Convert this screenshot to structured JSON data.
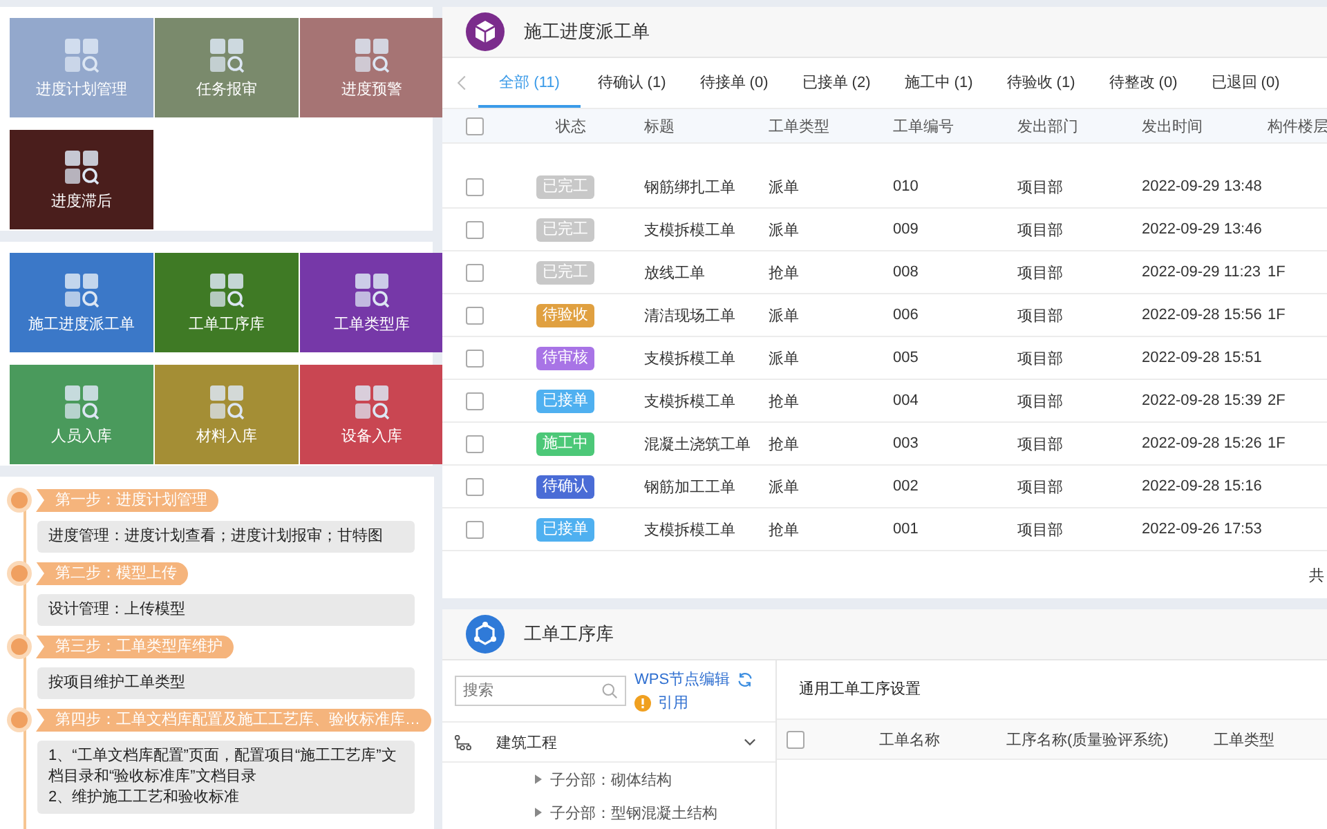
{
  "tile_groups": [
    {
      "tiles": [
        {
          "label": "进度计划管理",
          "color": "#93a8cc"
        },
        {
          "label": "任务报审",
          "color": "#7a8a6c"
        },
        {
          "label": "进度预警",
          "color": "#a67474"
        },
        {
          "label": "进度滞后",
          "color": "#4a1e1c"
        }
      ]
    },
    {
      "tiles": [
        {
          "label": "施工进度派工单",
          "color": "#3b78c8"
        },
        {
          "label": "工单工序库",
          "color": "#3f7a25"
        },
        {
          "label": "工单类型库",
          "color": "#7638a8"
        },
        {
          "label": "人员入库",
          "color": "#4a9a5c"
        },
        {
          "label": "材料入库",
          "color": "#a48e35"
        },
        {
          "label": "设备入库",
          "color": "#c94652"
        }
      ]
    }
  ],
  "steps": [
    {
      "title": "第一步：进度计划管理",
      "content": [
        "进度管理：进度计划查看；进度计划报审；甘特图"
      ]
    },
    {
      "title": "第二步：模型上传",
      "content": [
        "设计管理：上传模型"
      ]
    },
    {
      "title": "第三步：工单类型库维护",
      "content": [
        "按项目维护工单类型"
      ]
    },
    {
      "title": "第四步：工单文档库配置及施工工艺库、验收标准库…",
      "content": [
        "1、“工单文档库配置”页面，配置项目“施工工艺库”文档目录和“验收标准库”文档目录",
        "2、维护施工工艺和验收标准"
      ]
    }
  ],
  "work_orders": {
    "title": "施工进度派工单",
    "tabs": [
      {
        "label": "全部 (11)",
        "selected": true
      },
      {
        "label": "待确认 (1)",
        "selected": false
      },
      {
        "label": "待接单 (0)",
        "selected": false
      },
      {
        "label": "已接单 (2)",
        "selected": false
      },
      {
        "label": "施工中 (1)",
        "selected": false
      },
      {
        "label": "待验收 (1)",
        "selected": false
      },
      {
        "label": "待整改 (0)",
        "selected": false
      },
      {
        "label": "已退回 (0)",
        "selected": false
      }
    ],
    "header_checked": false,
    "columns": [
      "状态",
      "标题",
      "工单类型",
      "工单编号",
      "发出部门",
      "发出时间",
      "构件楼层"
    ],
    "rows": [
      {
        "checked": false,
        "status": "已完工",
        "color": "#c8c8c8",
        "title": "钢筋绑扎工单",
        "type": "派单",
        "number": "010",
        "dept": "项目部",
        "time": "2022-09-29 13:48",
        "floor": ""
      },
      {
        "checked": false,
        "status": "已完工",
        "color": "#c8c8c8",
        "title": "支模拆模工单",
        "type": "派单",
        "number": "009",
        "dept": "项目部",
        "time": "2022-09-29 13:46",
        "floor": ""
      },
      {
        "checked": false,
        "status": "已完工",
        "color": "#c8c8c8",
        "title": "放线工单",
        "type": "抢单",
        "number": "008",
        "dept": "项目部",
        "time": "2022-09-29 11:23",
        "floor": "1F"
      },
      {
        "checked": false,
        "status": "待验收",
        "color": "#e0a040",
        "title": "清洁现场工单",
        "type": "派单",
        "number": "006",
        "dept": "项目部",
        "time": "2022-09-28 15:56",
        "floor": "1F"
      },
      {
        "checked": false,
        "status": "待审核",
        "color": "#a874e6",
        "title": "支模拆模工单",
        "type": "派单",
        "number": "005",
        "dept": "项目部",
        "time": "2022-09-28 15:51",
        "floor": ""
      },
      {
        "checked": false,
        "status": "已接单",
        "color": "#4fb0f0",
        "title": "支模拆模工单",
        "type": "抢单",
        "number": "004",
        "dept": "项目部",
        "time": "2022-09-28 15:39",
        "floor": "2F"
      },
      {
        "checked": false,
        "status": "施工中",
        "color": "#4cc878",
        "title": "混凝土浇筑工单",
        "type": "抢单",
        "number": "003",
        "dept": "项目部",
        "time": "2022-09-28 15:26",
        "floor": "1F"
      },
      {
        "checked": false,
        "status": "待确认",
        "color": "#4a6cd6",
        "title": "钢筋加工工单",
        "type": "派单",
        "number": "002",
        "dept": "项目部",
        "time": "2022-09-28 15:16",
        "floor": ""
      },
      {
        "checked": false,
        "status": "已接单",
        "color": "#4fb0f0",
        "title": "支模拆模工单",
        "type": "抢单",
        "number": "001",
        "dept": "项目部",
        "time": "2022-09-26 17:53",
        "floor": ""
      }
    ],
    "total_label": "共"
  },
  "process_library": {
    "title": "工单工序库",
    "search": {
      "placeholder": "搜索"
    },
    "wps_link": "WPS节点编辑",
    "cite_link": "引用",
    "tree": {
      "label": "建筑工程",
      "expanded": true,
      "children": [
        {
          "label": "子分部：砌体结构"
        },
        {
          "label": "子分部：型钢混凝土结构"
        }
      ]
    },
    "settings_title": "通用工单工序设置",
    "header_checked": false,
    "columns": [
      "工单名称",
      "工序名称(质量验评系统)",
      "工单类型"
    ]
  }
}
